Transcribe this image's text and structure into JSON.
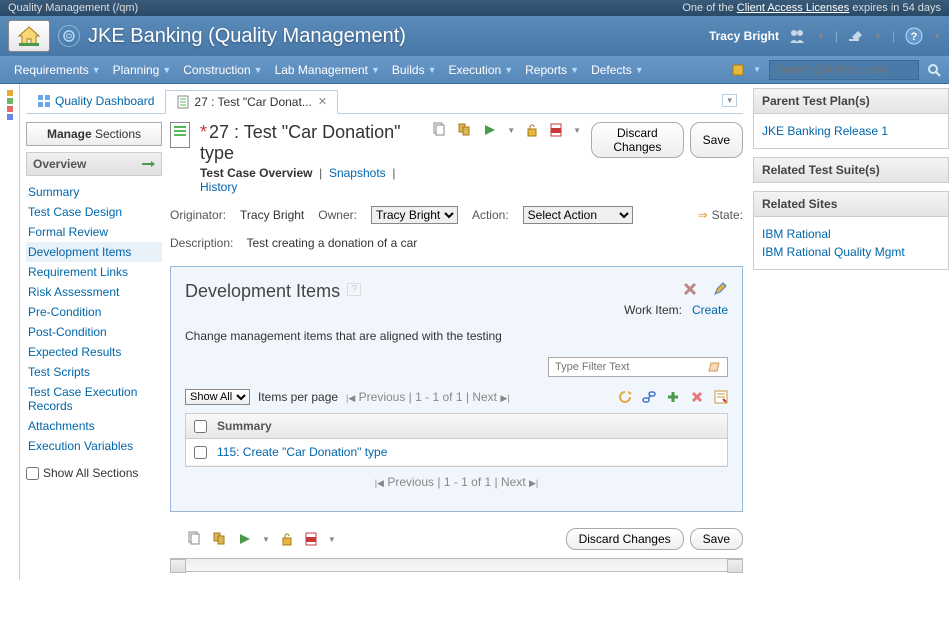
{
  "top_banner": {
    "left": "Quality Management (/qm)",
    "right_prefix": "One of the ",
    "right_link": "Client Access Licenses",
    "right_suffix": " expires in 54 days"
  },
  "brand": "JKE Banking (Quality Management)",
  "user": "Tracy Bright",
  "menu": [
    "Requirements",
    "Planning",
    "Construction",
    "Lab Management",
    "Builds",
    "Execution",
    "Reports",
    "Defects"
  ],
  "search_placeholder": "Search QM Resources",
  "tabs": {
    "dashboard": "Quality Dashboard",
    "active": "27 : Test \"Car Donat..."
  },
  "sidebar": {
    "manage_b": "Manage",
    "manage_rest": " Sections",
    "overview": "Overview",
    "items": [
      "Summary",
      "Test Case Design",
      "Formal Review",
      "Development Items",
      "Requirement Links",
      "Risk Assessment",
      "Pre-Condition",
      "Post-Condition",
      "Expected Results",
      "Test Scripts",
      "Test Case Execution Records",
      "Attachments",
      "Execution Variables"
    ],
    "selected_index": 3,
    "show_all": "Show All Sections"
  },
  "editor": {
    "title": "27 :   Test \"Car Donation\" type",
    "sub_bold": "Test Case Overview",
    "sub_snap": "Snapshots",
    "sub_hist": "History",
    "discard": "Discard Changes",
    "save": "Save",
    "originator_lbl": "Originator:",
    "originator_val": "Tracy Bright",
    "owner_lbl": "Owner:",
    "owner_val": "Tracy Bright",
    "action_lbl": "Action:",
    "action_val": "Select Action",
    "state_lbl": "State:",
    "desc_lbl": "Description:",
    "desc_val": "Test creating a donation of a car"
  },
  "panel": {
    "title": "Development Items",
    "work_item_lbl": "Work Item:",
    "create": "Create",
    "desc": "Change management items that are aligned with the testing",
    "filter_placeholder": "Type Filter Text",
    "show_all": "Show All",
    "ipp": "Items per page",
    "prev": "Previous",
    "range": "1 - 1 of 1",
    "next": "Next",
    "col_summary": "Summary",
    "row1": "115: Create \"Car Donation\" type"
  },
  "right": {
    "parent_hdr": "Parent Test Plan(s)",
    "parent_link": "JKE Banking Release 1",
    "suites_hdr": "Related Test Suite(s)",
    "sites_hdr": "Related Sites",
    "site1": "IBM Rational",
    "site2": "IBM Rational Quality Mgmt"
  }
}
